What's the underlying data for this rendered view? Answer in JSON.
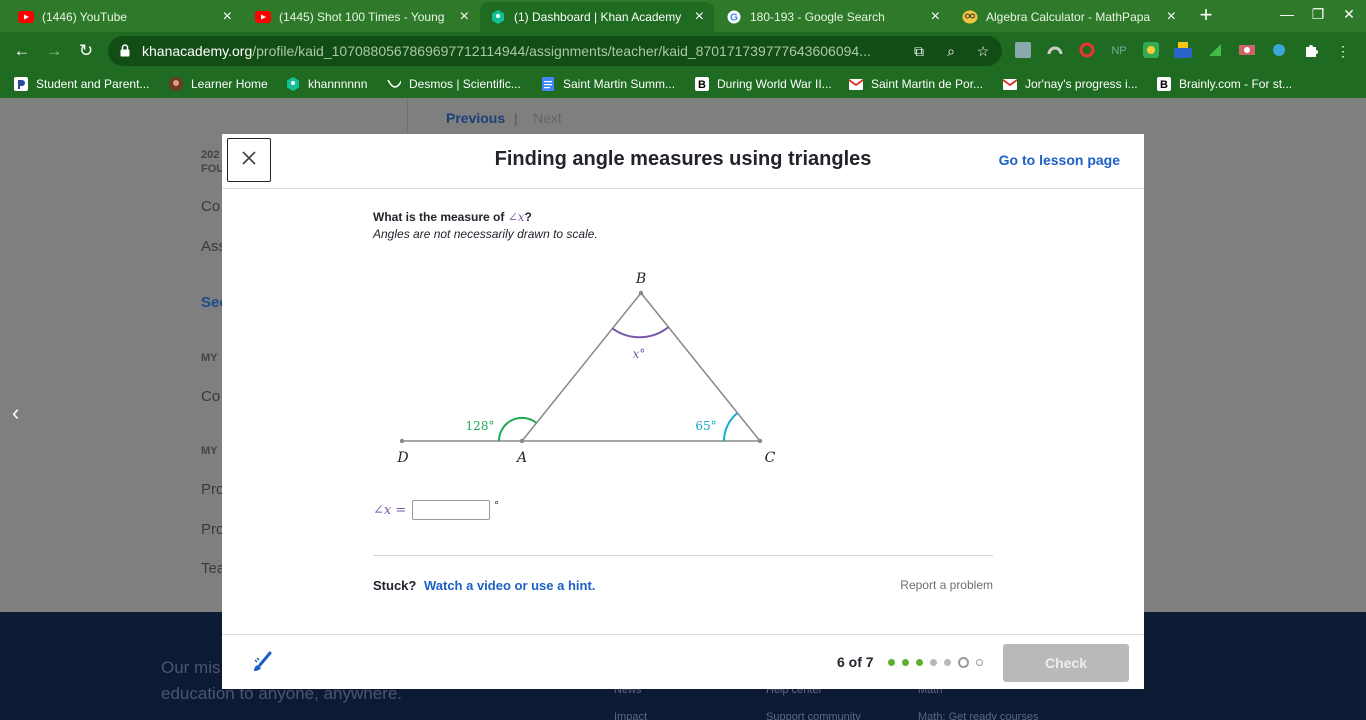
{
  "browser": {
    "tabs": [
      {
        "title": "(1446) YouTube",
        "icon": "youtube-icon",
        "active": false
      },
      {
        "title": "(1445) Shot 100 Times - Young",
        "icon": "youtube-icon",
        "active": false
      },
      {
        "title": "(1) Dashboard | Khan Academy",
        "icon": "khan-academy-icon",
        "active": true
      },
      {
        "title": "180-193 - Google Search",
        "icon": "google-icon",
        "active": false
      },
      {
        "title": "Algebra Calculator - MathPapa",
        "icon": "mathpapa-icon",
        "active": false
      }
    ],
    "url_host": "khanacademy.org",
    "url_path": "/profile/kaid_1070880567869697712114944/assignments/teacher/kaid_870171739777643606094...",
    "bookmarks": [
      {
        "label": "Student and Parent...",
        "icon": "parentsquare-icon"
      },
      {
        "label": "Learner Home",
        "icon": "avatar-icon"
      },
      {
        "label": "khannnnnn",
        "icon": "khan-academy-icon"
      },
      {
        "label": "Desmos | Scientific...",
        "icon": "desmos-icon"
      },
      {
        "label": "Saint Martin Summ...",
        "icon": "docs-icon"
      },
      {
        "label": "During World War II...",
        "icon": "brainly-icon"
      },
      {
        "label": "Saint Martin de Por...",
        "icon": "gmail-icon"
      },
      {
        "label": "Jor'nay's progress i...",
        "icon": "gmail-icon"
      },
      {
        "label": "Brainly.com - For st...",
        "icon": "brainly-icon"
      }
    ]
  },
  "background_page": {
    "nav_previous": "Previous",
    "nav_sep": "|",
    "nav_next": "Next",
    "left_items": [
      "202",
      "FOU",
      "Co",
      "Ass",
      "See",
      "MY",
      "Co",
      "MY",
      "Pro",
      "Pro",
      "Tea"
    ],
    "footer_text_1": "Our mis",
    "footer_text_2": "education to anyone, anywhere.",
    "footer_links": [
      "News",
      "Help center",
      "Math",
      "Impact",
      "Support community",
      "Math: Get ready courses"
    ]
  },
  "modal": {
    "title": "Finding angle measures using triangles",
    "lesson_link": "Go to lesson page",
    "question_prefix": "What is the measure of",
    "question_var": "∠x",
    "question_suffix": "?",
    "note": "Angles are not necessarily drawn to scale.",
    "diagram": {
      "label_B": "B",
      "label_A": "A",
      "label_C": "C",
      "label_D": "D",
      "angle_x": "x°",
      "angle_128": "128°",
      "angle_65": "65°"
    },
    "answer_label": "∠x =",
    "answer_value": "",
    "answer_unit": "°",
    "stuck_label": "Stuck?",
    "hint_link": "Watch a video or use a hint.",
    "report_link": "Report a problem",
    "progress_text": "6 of 7",
    "check_label": "Check"
  },
  "colors": {
    "purple": "#7854ab",
    "green": "#1fab54",
    "teal": "#11accd",
    "link_blue": "#1c5fc6"
  }
}
